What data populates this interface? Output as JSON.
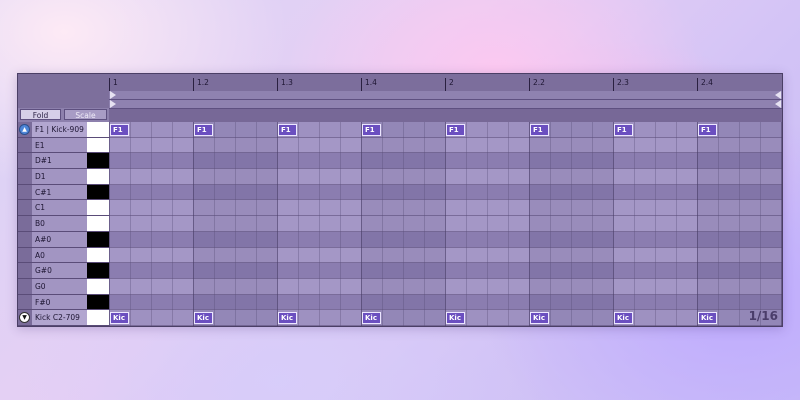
{
  "buttons": {
    "fold": "Fold",
    "scale": "Scale"
  },
  "keys": [
    {
      "label": "F1 | Kick-909",
      "swatch": "white",
      "named": true,
      "icon": "up"
    },
    {
      "label": "E1",
      "swatch": "white"
    },
    {
      "label": "D#1",
      "swatch": "black"
    },
    {
      "label": "D1",
      "swatch": "white"
    },
    {
      "label": "C#1",
      "swatch": "black"
    },
    {
      "label": "C1",
      "swatch": "white"
    },
    {
      "label": "B0",
      "swatch": "white"
    },
    {
      "label": "A#0",
      "swatch": "black"
    },
    {
      "label": "A0",
      "swatch": "white"
    },
    {
      "label": "G#0",
      "swatch": "black"
    },
    {
      "label": "G0",
      "swatch": "white"
    },
    {
      "label": "F#0",
      "swatch": "black"
    },
    {
      "label": "Kick C2-709",
      "swatch": "white",
      "named": true,
      "icon": "down"
    }
  ],
  "ruler": [
    "1",
    "1.2",
    "1.3",
    "1.4",
    "2",
    "2.2",
    "2.3",
    "2.4"
  ],
  "notes_top": [
    "F1",
    "F1",
    "F1",
    "F1",
    "F1",
    "F1",
    "F1",
    "F1"
  ],
  "notes_bottom": [
    "Kic",
    "Kic",
    "Kic",
    "Kic",
    "Kic",
    "Kic",
    "Kic",
    "Kic"
  ],
  "grid_counter": "1/16",
  "colors": {
    "accent": "#6b4fc0",
    "panel": "#6e5f91"
  }
}
